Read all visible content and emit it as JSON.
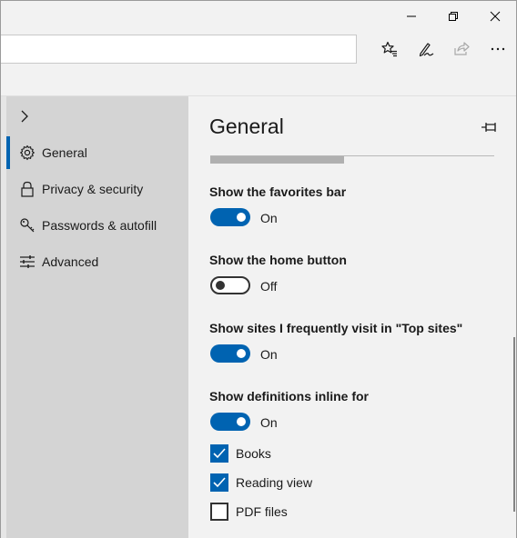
{
  "window": {
    "controls": {
      "minimize": "minimize-icon",
      "restore": "restore-icon",
      "close": "close-icon"
    }
  },
  "toolbar": {
    "address_value": "",
    "icons": [
      "favorites-star-icon",
      "pen-icon",
      "share-icon",
      "more-icon"
    ]
  },
  "nav": {
    "expand_icon": "chevron-right-icon",
    "items": [
      {
        "label": "General",
        "icon": "gear-icon",
        "selected": true
      },
      {
        "label": "Privacy & security",
        "icon": "lock-icon",
        "selected": false
      },
      {
        "label": "Passwords & autofill",
        "icon": "key-icon",
        "selected": false
      },
      {
        "label": "Advanced",
        "icon": "sliders-icon",
        "selected": false
      }
    ]
  },
  "panel": {
    "title": "General",
    "pin_icon": "pin-icon",
    "settings": [
      {
        "label": "Show the favorites bar",
        "state": "On",
        "on": true
      },
      {
        "label": "Show the home button",
        "state": "Off",
        "on": false
      },
      {
        "label": "Show sites I frequently visit in \"Top sites\"",
        "state": "On",
        "on": true
      },
      {
        "label": "Show definitions inline for",
        "state": "On",
        "on": true
      }
    ],
    "definitions": [
      {
        "label": "Books",
        "checked": true
      },
      {
        "label": "Reading view",
        "checked": true
      },
      {
        "label": "PDF files",
        "checked": false
      }
    ]
  },
  "colors": {
    "accent": "#0063b1",
    "nav_background": "#d4d4d4",
    "panel_background": "#f2f2f2"
  }
}
